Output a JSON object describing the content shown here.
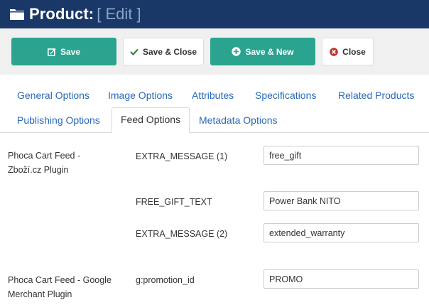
{
  "header": {
    "title": "Product:",
    "subtitle": "[ Edit ]"
  },
  "toolbar": {
    "save_label": "Save",
    "save_close_label": "Save & Close",
    "save_new_label": "Save & New",
    "close_label": "Close"
  },
  "tabs": [
    {
      "label": "General Options"
    },
    {
      "label": "Image Options"
    },
    {
      "label": "Attributes"
    },
    {
      "label": "Specifications"
    },
    {
      "label": "Related Products"
    },
    {
      "label": "Publishing Options"
    },
    {
      "label": "Feed Options",
      "active": true
    },
    {
      "label": "Metadata Options"
    }
  ],
  "sections": [
    {
      "title": "Phoca Cart Feed - Zboží.cz Plugin",
      "fields": [
        {
          "label": "EXTRA_MESSAGE (1)",
          "value": "free_gift"
        },
        {
          "label": "FREE_GIFT_TEXT",
          "value": "Power Bank NITO"
        },
        {
          "label": "EXTRA_MESSAGE (2)",
          "value": "extended_warranty"
        }
      ]
    },
    {
      "title": "Phoca Cart Feed - Google Merchant Plugin",
      "fields": [
        {
          "label": "g:promotion_id",
          "value": "PROMO"
        }
      ]
    }
  ],
  "colors": {
    "header_bg": "#1a3867",
    "primary_button": "#2aa48f",
    "link": "#2a69b8",
    "close_icon": "#bd362f"
  }
}
